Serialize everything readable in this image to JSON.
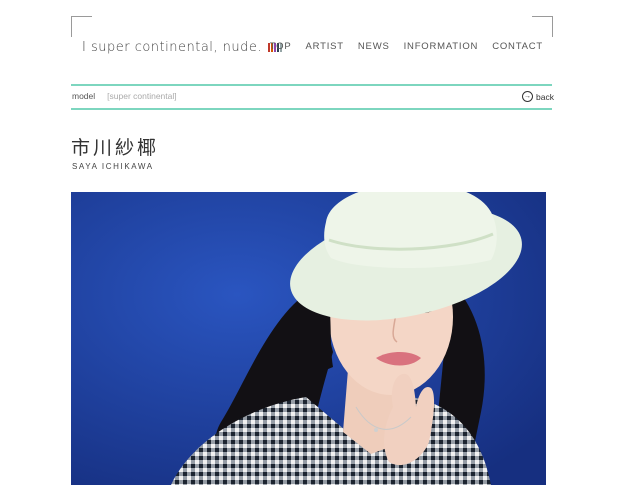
{
  "logo": {
    "text": "I super continental, nude.",
    "bar_colors": [
      "#c0392b",
      "#d35400",
      "#8e44ad",
      "#2c3e50",
      "#95a5a6"
    ]
  },
  "nav": {
    "items": [
      "TOP",
      "ARTIST",
      "NEWS",
      "INFORMATION",
      "CONTACT"
    ]
  },
  "breadcrumb": {
    "category": "model",
    "agency": "[super continental]"
  },
  "back_label": "back",
  "profile": {
    "name_jp": "市川紗椰",
    "name_en": "SAYA ICHIKAWA"
  },
  "colors": {
    "accent_rule": "#7dd6bf",
    "photo_background": "#1f3f9a"
  }
}
